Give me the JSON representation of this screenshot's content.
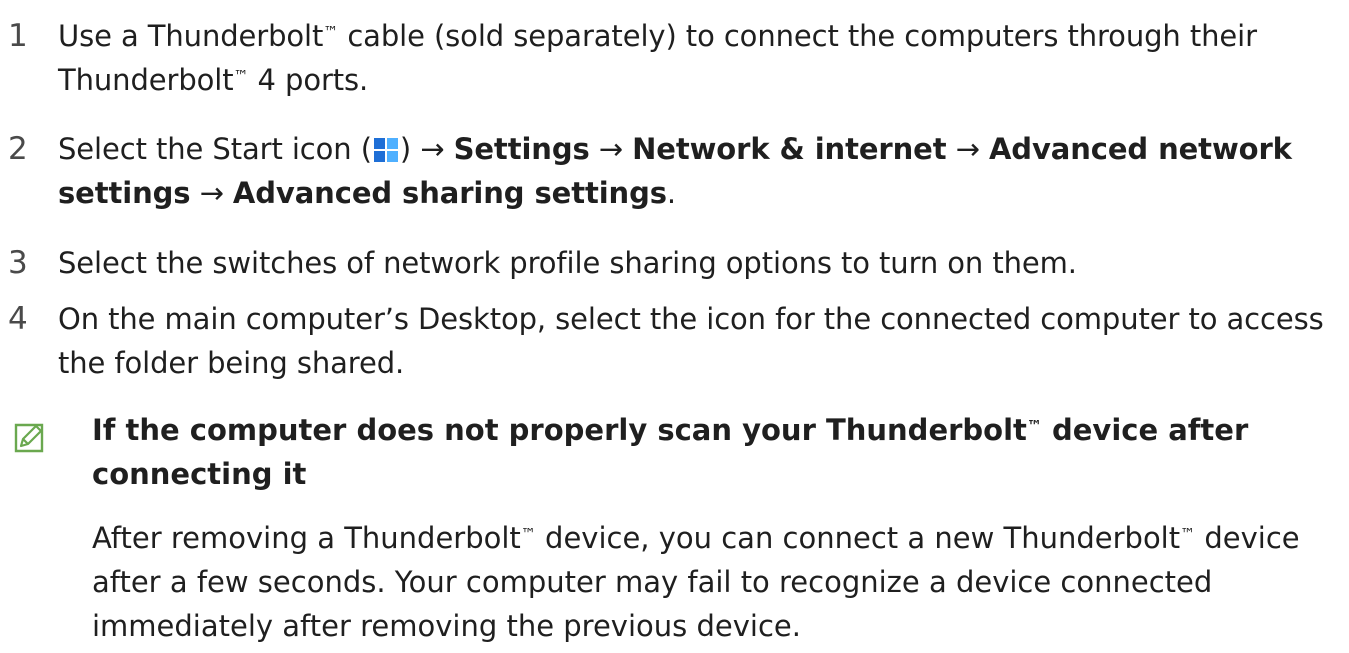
{
  "steps": [
    {
      "number": "1",
      "line1_a": "Use a Thunderbolt",
      "tm": "™",
      "line1_b": " cable (sold separately) to connect the computers through their",
      "line2_a": "Thunderbolt",
      "line2_b": " 4 ports."
    },
    {
      "number": "2",
      "text_a": "Select the Start icon (",
      "text_b": ") → ",
      "settings": "Settings",
      "arrow1": " → ",
      "network": "Network & internet",
      "arrow2": " → ",
      "advanced_network": "Advanced network settings",
      "arrow3": " → ",
      "advanced_sharing": "Advanced sharing settings",
      "period": "."
    },
    {
      "number": "3",
      "text": "Select the switches of network profile sharing options to turn on them."
    },
    {
      "number": "4",
      "text": "On the main computer’s Desktop, select the icon for the connected computer to access the folder being shared."
    }
  ],
  "note": {
    "icon": "note-pencil-icon",
    "title_a": "If the computer does not properly scan your Thunderbolt",
    "title_b": " device after connecting it",
    "body_a": "After removing a Thunderbolt",
    "body_b": " device, you can connect a new Thunderbolt",
    "body_c": " device after a few seconds. Your computer may fail to recognize a device connected immediately after removing the previous device."
  },
  "colors": {
    "text": "#1f1f1f",
    "number": "#4a4a4a",
    "note_icon": "#6aa84f",
    "win_blue_dark": "#1f6fd6",
    "win_blue_light": "#4fb0ff"
  }
}
